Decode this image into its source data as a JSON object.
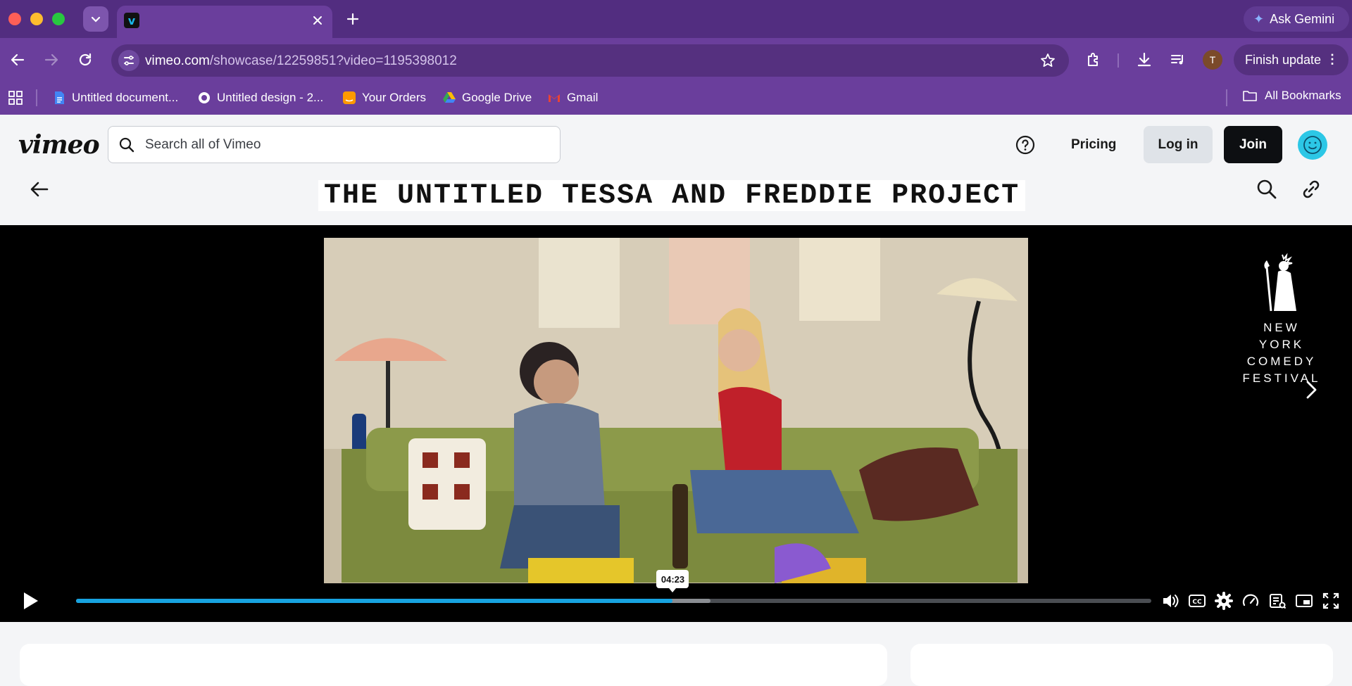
{
  "browser": {
    "tab_title": "",
    "ask_gemini": "Ask Gemini",
    "url_host": "vimeo.com",
    "url_path": "/showcase/12259851?video=1195398012",
    "profile_initial": "T",
    "finish_update": "Finish update",
    "bookmarks": [
      {
        "label": "Untitled document...",
        "icon": "google-docs-icon",
        "color": "#4285f4"
      },
      {
        "label": "Untitled design - 2...",
        "icon": "globe-icon",
        "color": "#ffffff"
      },
      {
        "label": "Your Orders",
        "icon": "amazon-icon",
        "color": "#ff9900"
      },
      {
        "label": "Google Drive",
        "icon": "google-drive-icon",
        "color": "#34a853"
      },
      {
        "label": "Gmail",
        "icon": "gmail-icon",
        "color": "#ea4335"
      }
    ],
    "all_bookmarks": "All Bookmarks"
  },
  "vimeo": {
    "logo": "vimeo",
    "search_placeholder": "Search all of Vimeo",
    "pricing": "Pricing",
    "login": "Log in",
    "join": "Join",
    "showcase_title": "THE UNTITLED TESSA AND FREDDIE PROJECT"
  },
  "player": {
    "watermark": [
      "NEW YORK",
      "COMEDY",
      "FESTIVAL"
    ],
    "time_tooltip": "04:23",
    "progress_fraction": 0.555,
    "buffered_fraction": 0.59,
    "controls": [
      "volume-icon",
      "captions-icon",
      "settings-icon",
      "speed-icon",
      "transcript-icon",
      "pip-icon",
      "fullscreen-icon"
    ]
  },
  "colors": {
    "accent": "#17a3e0",
    "chrome_purple": "#6a3e9c",
    "join_bg": "#0d0f12",
    "avatar": "#2cc7e6"
  }
}
